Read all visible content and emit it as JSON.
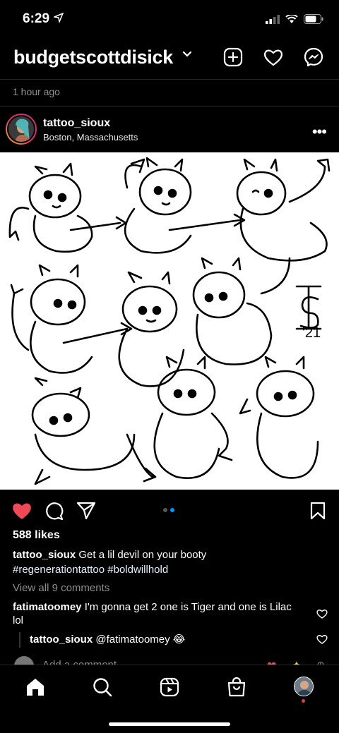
{
  "status": {
    "time": "6:29"
  },
  "header": {
    "username": "budgetscottdisick"
  },
  "post": {
    "time_ago": "1 hour ago",
    "user": "tattoo_sioux",
    "location": "Boston, Massachusetts",
    "image_marks": {
      "year": "'21"
    },
    "likes": "588 likes",
    "caption_user": "tattoo_sioux",
    "caption_text": "Get a lil devil on your booty",
    "hashtag1": "#regenerationtattoo",
    "hashtag2": "#boldwillhold",
    "view_comments": "View all 9 comments",
    "comments": [
      {
        "user": "fatimatoomey",
        "text": "I'm gonna get 2 one is Tiger and one is Lilac lol"
      },
      {
        "user": "tattoo_sioux",
        "text": "@fatimatoomey 😂"
      }
    ],
    "add_comment_placeholder": "Add a comment..."
  },
  "carousel": {
    "current": 2,
    "total": 2
  },
  "colors": {
    "like": "#ed4956",
    "active_dot": "#0095f6",
    "inactive_dot": "#555555",
    "background": "#000000"
  },
  "icons": {
    "header": [
      "new-post-icon",
      "heart-icon",
      "messenger-icon"
    ],
    "actions": [
      "liked-heart-icon",
      "comment-icon",
      "share-icon",
      "bookmark-icon"
    ],
    "tabs": [
      "home-icon",
      "search-icon",
      "reels-icon",
      "shop-icon",
      "profile-avatar"
    ]
  }
}
